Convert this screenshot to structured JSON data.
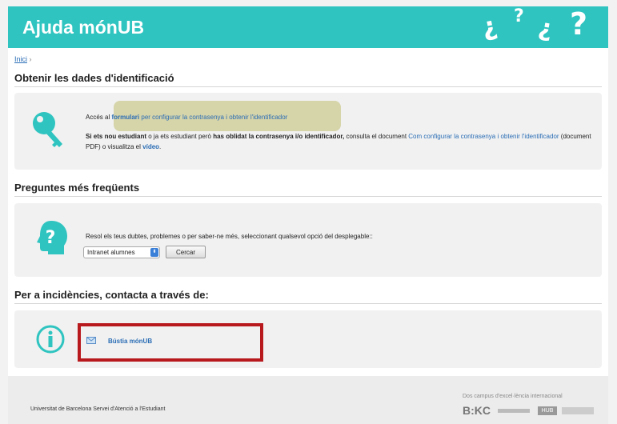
{
  "header": {
    "title": "Ajuda mónUB",
    "q1": "¿",
    "q2": "?",
    "q3": "¿",
    "q4": "?"
  },
  "breadcrumb": {
    "home": "Inici",
    "sep": "›"
  },
  "section1": {
    "title": "Obtenir les dades d'identificació",
    "line1_pre": "Accés al ",
    "line1_link": "formulari",
    "line1_post": " per configurar la contrasenya i obtenir l'identificador",
    "line2_b1": "Si ets nou estudiant",
    "line2_t1": " o ja ets estudiant però ",
    "line2_b2": "has oblidat la contrasenya i/o identificador,",
    "line2_t2": " consulta el document ",
    "line2_link1": "Com configurar la contrasenya i obtenir l'identificador",
    "line2_t3": " (document PDF) o visualitza el ",
    "line2_link2": "vídeo",
    "line2_t4": "."
  },
  "section2": {
    "title": "Preguntes més freqüents",
    "text": "Resol els teus dubtes, problemes o per saber-ne més, seleccionant qualsevol opció del desplegable::",
    "select_value": "Intranet alumnes",
    "button": "Cercar"
  },
  "section3": {
    "title": "Per a incidències, contacta a través de:",
    "link": "Bústia mónUB"
  },
  "footer": {
    "left": "Universitat de Barcelona   Servei d'Atenció a l'Estudiant",
    "right": "Dos campus d'excel·lència internacional",
    "logo1": "B:KC",
    "logo2": "HUB"
  },
  "colors": {
    "brand": "#2fc4c0",
    "link": "#2a6db5",
    "highlight": "#d6d4a9",
    "annotation": "#b8191d"
  },
  "icons": [
    "key-icon",
    "question-head-icon",
    "info-icon",
    "mail-icon"
  ]
}
